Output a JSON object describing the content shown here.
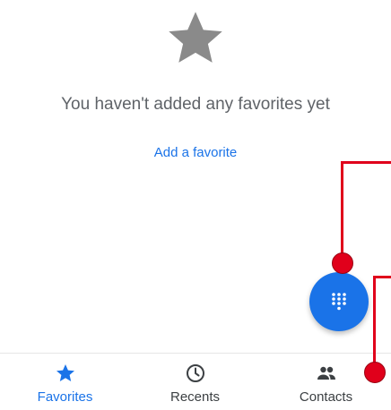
{
  "empty_state": {
    "icon": "star-icon",
    "message": "You haven't added any favorites yet",
    "action_label": "Add a favorite"
  },
  "fab": {
    "icon": "dialpad-icon"
  },
  "bottom_nav": {
    "items": [
      {
        "label": "Favorites",
        "icon": "star-icon",
        "active": true
      },
      {
        "label": "Recents",
        "icon": "clock-icon",
        "active": false
      },
      {
        "label": "Contacts",
        "icon": "people-icon",
        "active": false
      }
    ]
  },
  "colors": {
    "accent": "#1a73e8",
    "muted_icon": "#8a8a8a",
    "annotation": "#e0001b"
  }
}
